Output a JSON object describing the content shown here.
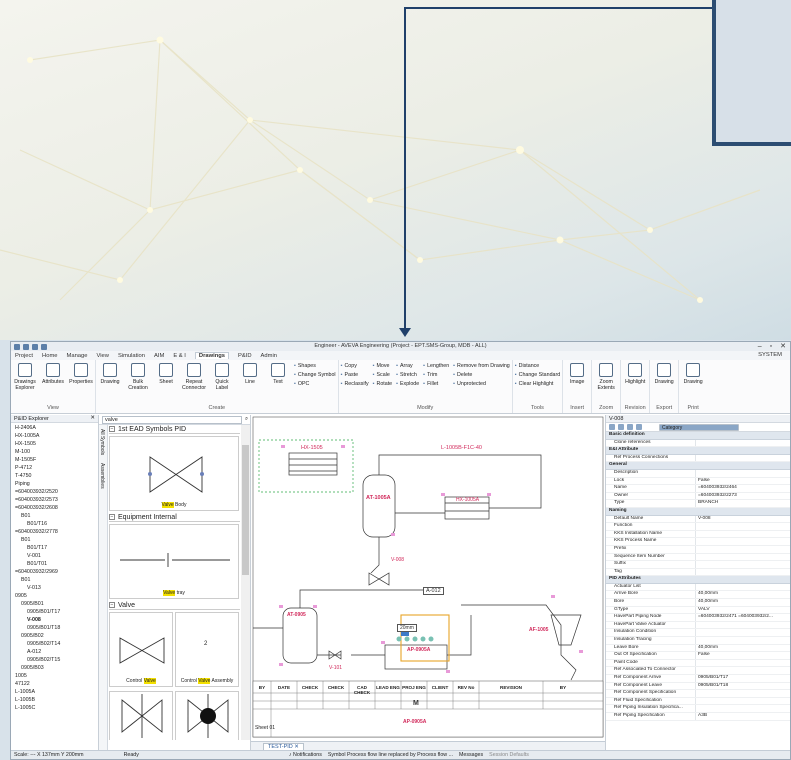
{
  "window": {
    "title": "Engineer - AVEVA Engineering (Project - EPT.SMS-Group, MDB - ALL)",
    "controls": [
      "–",
      "▫",
      "✕"
    ]
  },
  "menu": {
    "items": [
      "Project",
      "Home",
      "Manage",
      "View",
      "Simulation",
      "AIM",
      "E & I",
      "Drawings",
      "P&ID",
      "Admin"
    ],
    "active_index": 7,
    "system": "SYSTEM"
  },
  "ribbon": {
    "view": {
      "label": "View",
      "drawings_explorer": "Drawings Explorer",
      "attributes": "Attributes",
      "properties": "Properties"
    },
    "create": {
      "label": "Create",
      "drawing": "Drawing",
      "bulk_creation": "Bulk Creation",
      "sheet": "Sheet",
      "repeat_connector": "Repeat Connector",
      "quick_label": "Quick Label",
      "line": "Line",
      "text": "Text",
      "shapes": "Shapes",
      "change_symbol": "Change Symbol",
      "opc": "OPC"
    },
    "modify": {
      "label": "Modify",
      "copy": "Copy",
      "paste": "Paste",
      "reclassify": "Reclassify",
      "move": "Move",
      "scale": "Scale",
      "rotate": "Rotate",
      "array": "Array",
      "stretch": "Stretch",
      "explode": "Explode",
      "lengthen": "Lengthen",
      "trim": "Trim",
      "fillet": "Fillet",
      "remove_from_drawing": "Remove from Drawing",
      "delete": "Delete",
      "unprotected": "Unprotected"
    },
    "tools": {
      "label": "Tools",
      "distance": "Distance",
      "change_standard": "Change Standard",
      "clear_highlight": "Clear Highlight"
    },
    "insert": {
      "label": "Insert",
      "image": "Image"
    },
    "zoom": {
      "label": "Zoom",
      "zoom_extents": "Zoom Extents"
    },
    "revision": {
      "label": "Revision",
      "highlight": "Highlight"
    },
    "export": {
      "label": "Export",
      "drawing": "Drawing"
    },
    "print": {
      "label": "Print",
      "drawing": "Drawing"
    }
  },
  "explorer": {
    "title": "P&ID Explorer",
    "items": [
      "H-2406A",
      "HX-1005A",
      "HX-1505",
      "M-100",
      "M-1505F",
      "P-4712",
      "T-4750",
      "Piping",
      "=604003932/2520",
      "=604003932/2573",
      "=604003932/2608",
      "B01",
      "B01/T16",
      "=604003932/2778",
      "B01",
      "B01/T17",
      "V-001",
      "B01/T01",
      "=604003932/2969",
      "B01",
      "V-013",
      "0905",
      "0905/B01",
      "0905/B01/T17",
      "V-008",
      "0905/B01/T18",
      "0905/B02",
      "0905/B02/T14",
      "A-012",
      "0905/B02/T15",
      "0905/B03",
      "1005",
      "47122",
      "L-1005A",
      "L-1005B",
      "L-1005C"
    ]
  },
  "symbols": {
    "search": "valve",
    "tabs": [
      "All Symbols",
      "Assemblies"
    ],
    "group1": "1st EAD Symbols PID",
    "group2": "Equipment Internal",
    "group3": "Valve",
    "cap1_pre": "",
    "cap1_hl": "Valve",
    "cap1_post": " Body",
    "cap2_pre": "",
    "cap2_hl": "Valve",
    "cap2_post": " tray",
    "cap3_pre": "Control ",
    "cap3_hl": "Valve",
    "cap3_post": "",
    "cap4_pre": "Control ",
    "cap4_hl": "Valve",
    "cap4_post": " Assembly",
    "cell4_num": "2"
  },
  "drawing": {
    "tab": "TEST-PID",
    "labels": {
      "hx1505": "HX-1505",
      "line": "L-1005B-F1C-40",
      "at1005a": "AT-1005A",
      "hx1005a": "HX-1005A",
      "v008": "V-008",
      "a012": "A-012",
      "at0905": "AT-0905",
      "af1005": "AF-1005",
      "ap0905a_top": "AP-0905A",
      "ap0905a_bot": "AP-0905A",
      "v101": "V-101",
      "size": "20mm",
      "motor": "M"
    },
    "titleblock": [
      "BY",
      "DATE",
      "CHECK",
      "CHECK",
      "CAD CHECK",
      "LEAD ENG",
      "PROJ ENG",
      "CLIENT",
      "REV No",
      "REVISION",
      "BY"
    ],
    "sheet": "Sheet 01"
  },
  "props": {
    "object": "V-008",
    "view_mode": "Category",
    "sections": [
      {
        "name": "Basic definition",
        "rows": [
          [
            "Clone references",
            ""
          ]
        ]
      },
      {
        "name": "E&I Attribute",
        "rows": [
          [
            "Ref Process Connections",
            ""
          ]
        ]
      },
      {
        "name": "General",
        "rows": [
          [
            "Description",
            ""
          ],
          [
            "Lock",
            "False"
          ],
          [
            "Name",
            "=604003932/2464"
          ],
          [
            "Owner",
            "=604003932/2273"
          ],
          [
            "Type",
            "BRANCH"
          ]
        ]
      },
      {
        "name": "Naming",
        "rows": [
          [
            "Default Name",
            "V-008"
          ],
          [
            "Function",
            ""
          ],
          [
            "KKS Installation Name",
            ""
          ],
          [
            "KKS Process Name",
            ""
          ],
          [
            "Prefix",
            ""
          ],
          [
            "Sequence Item Number",
            ""
          ],
          [
            "Suffix",
            ""
          ],
          [
            "Tag",
            ""
          ]
        ]
      },
      {
        "name": "PID Attributes",
        "rows": [
          [
            "Actuator List",
            ""
          ],
          [
            "Arrive Bore",
            "40,00mm"
          ],
          [
            "Bore",
            "40,00mm"
          ],
          [
            "GType",
            "VALV"
          ],
          [
            "HavePart Piping Node",
            "=604003932/2471 =604003932/2..."
          ],
          [
            "HavePart Valve Actuator",
            ""
          ],
          [
            "Insulation Condition",
            ""
          ],
          [
            "Insulation Tracing",
            ""
          ],
          [
            "Leave Bore",
            "40,00mm"
          ],
          [
            "Out Of Specification",
            "False"
          ],
          [
            "Paint Code",
            ""
          ],
          [
            "Ref Associated To Connector",
            ""
          ],
          [
            "Ref Component Arrive",
            "0905/B01/T17"
          ],
          [
            "Ref Component Leave",
            "0905/B01/T18"
          ],
          [
            "Ref Component Specification",
            ""
          ],
          [
            "Ref Fluid Specification",
            ""
          ],
          [
            "Ref Piping Insulation Specifica...",
            ""
          ],
          [
            "Ref Piping Specification",
            "A3B"
          ]
        ]
      }
    ]
  },
  "status": {
    "scale": "Scale: --- X 137mm Y 200mm",
    "ready": "Ready",
    "notifications": "Notifications",
    "message": "Symbol Process flow line replaced by Process flow ...",
    "messages": "Messages",
    "session": "Session Defaults"
  }
}
